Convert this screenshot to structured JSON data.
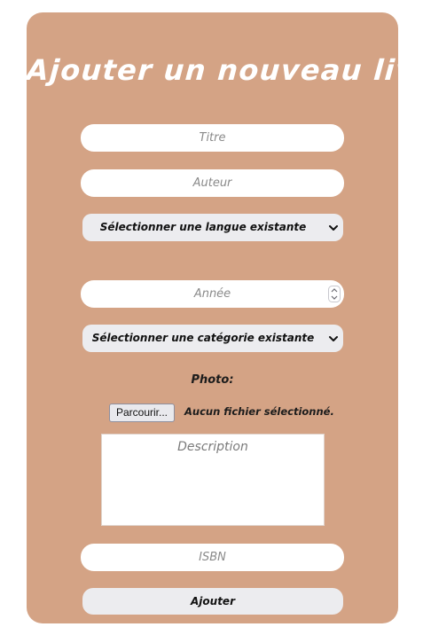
{
  "form": {
    "title": "Ajouter un nouveau livre",
    "fields": {
      "titre": {
        "value": "",
        "placeholder": "Titre"
      },
      "auteur": {
        "value": "",
        "placeholder": "Auteur"
      },
      "annee": {
        "value": "",
        "placeholder": "Année"
      },
      "isbn": {
        "value": "",
        "placeholder": "ISBN"
      },
      "description": {
        "value": "",
        "placeholder": "Description"
      }
    },
    "langue_select": {
      "selected": "Sélectionner une langue existante"
    },
    "categorie_select": {
      "selected": "Sélectionner une catégorie existante"
    },
    "photo": {
      "label": "Photo:",
      "browse_label": "Parcourir...",
      "status": "Aucun fichier sélectionné."
    },
    "submit_label": "Ajouter"
  },
  "colors": {
    "card_background": "#d4a385",
    "input_background": "#ffffff",
    "select_background": "#ececef",
    "title_color": "#ffffff"
  },
  "icons": {
    "select_arrow": "chevron-down-icon",
    "number_spinner": "spinner-updown-icon"
  }
}
